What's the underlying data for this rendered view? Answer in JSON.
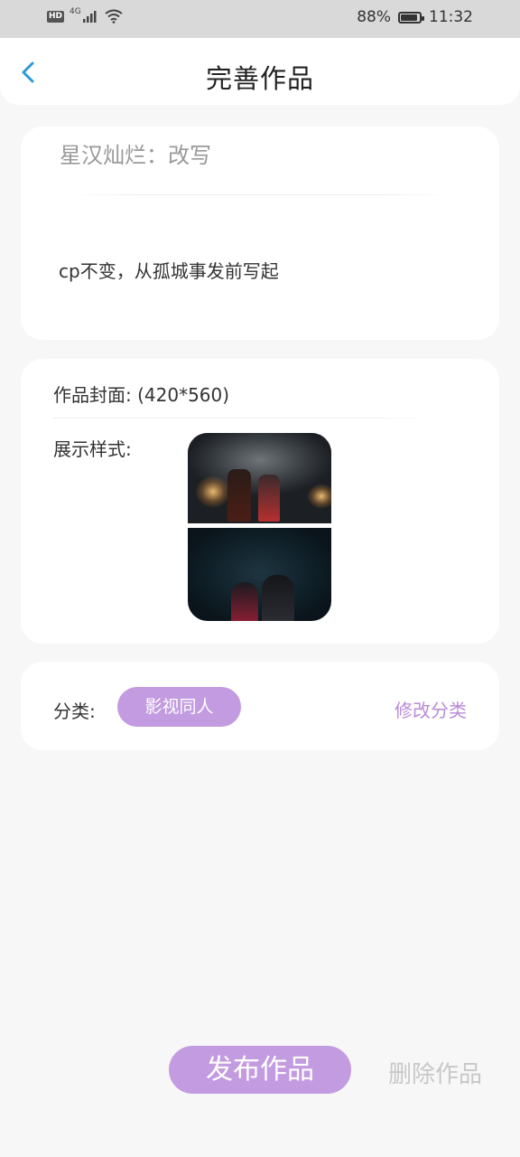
{
  "status_bar": {
    "hd": "HD",
    "network": "4G",
    "battery": "88%",
    "battery_level": 0.88,
    "time": "11:32"
  },
  "header": {
    "back_icon": "chevron-left-icon",
    "title": "完善作品"
  },
  "work": {
    "title": "星汉灿烂：改写",
    "description": "cp不变，从孤城事发前写起"
  },
  "cover": {
    "label": "作品封面: (420*560)",
    "display_label": "展示样式:"
  },
  "category": {
    "label": "分类:",
    "value": "影视同人",
    "edit_label": "修改分类"
  },
  "actions": {
    "publish": "发布作品",
    "delete": "删除作品"
  },
  "colors": {
    "accent": "#c39be0",
    "back_icon": "#2a9ad8"
  }
}
